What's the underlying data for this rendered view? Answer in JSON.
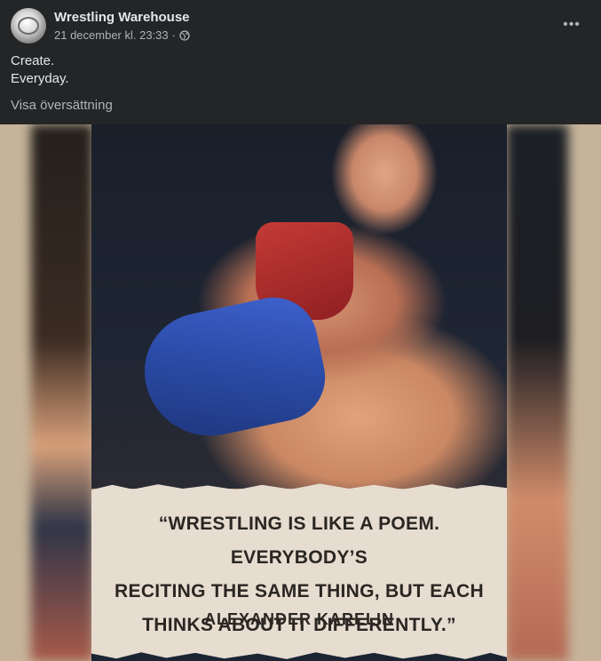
{
  "post": {
    "page_name": "Wrestling Warehouse",
    "timestamp": "21 december kl. 23:33",
    "separator": "·",
    "audience_icon": "globe-icon",
    "caption_line1": "Create.",
    "caption_line2": "Everyday.",
    "translate_label": "Visa översättning",
    "more_icon": "more-horizontal-icon",
    "more_glyph": "•••"
  },
  "media": {
    "quote_line1": "“WRESTLING IS LIKE A POEM. EVERYBODY’S",
    "quote_line2": "RECITING THE SAME THING, BUT EACH",
    "quote_line3": "THINKS ABOUT IT DIFFERENTLY.”",
    "author": "ALEXANDER  KARELIN"
  },
  "colors": {
    "background": "#242526",
    "text_primary": "#e4e6eb",
    "text_secondary": "#b0b3b8",
    "quote_panel": "#e6dcd0"
  }
}
